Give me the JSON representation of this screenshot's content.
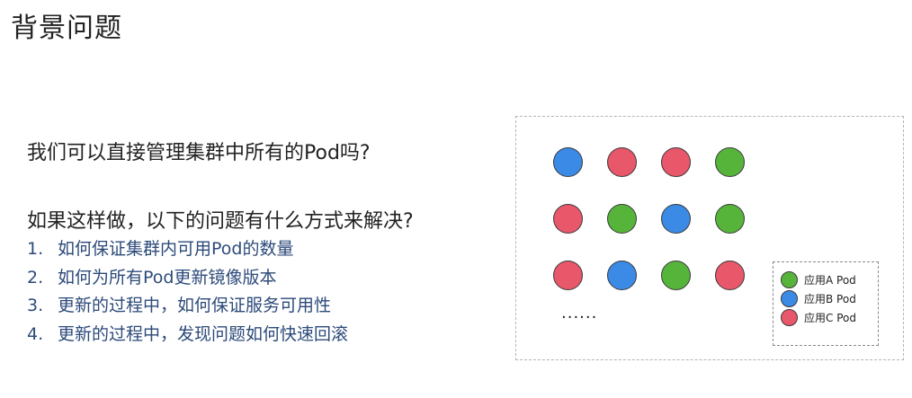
{
  "title": "背景问题",
  "question_main": "我们可以直接管理集群中所有的Pod吗?",
  "question_sub": "如果这样做，以下的问题有什么方式来解决?",
  "issues": [
    {
      "num": "1.",
      "text": "如何保证集群内可用Pod的数量"
    },
    {
      "num": "2.",
      "text": "如何为所有Pod更新镜像版本"
    },
    {
      "num": "3.",
      "text": "更新的过程中，如何保证服务可用性"
    },
    {
      "num": "4.",
      "text": "更新的过程中，发现问题如何快速回滚"
    }
  ],
  "diagram": {
    "colors": {
      "A": "#56b43a",
      "B": "#3a8ae6",
      "C": "#e8576a"
    },
    "grid": [
      [
        "B",
        "C",
        "C",
        "A"
      ],
      [
        "C",
        "A",
        "B",
        "A"
      ],
      [
        "C",
        "B",
        "A",
        "C"
      ]
    ],
    "ellipsis": "......",
    "legend": [
      {
        "app": "A",
        "label": "应用A Pod"
      },
      {
        "app": "B",
        "label": "应用B Pod"
      },
      {
        "app": "C",
        "label": "应用C Pod"
      }
    ]
  }
}
